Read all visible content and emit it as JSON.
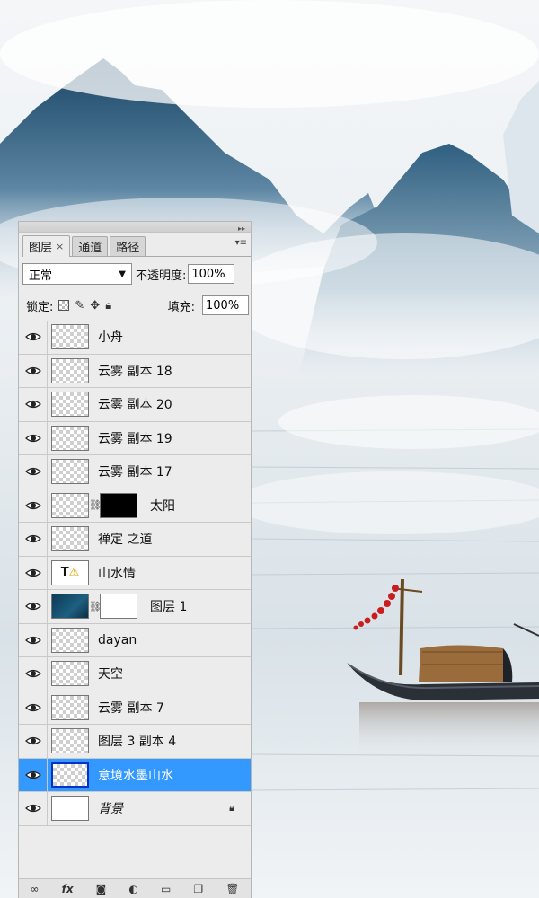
{
  "panel": {
    "tabs": [
      {
        "label": "图层",
        "close": "×"
      },
      {
        "label": "通道"
      },
      {
        "label": "路径"
      }
    ],
    "blend_mode": "正常",
    "opacity_label": "不透明度:",
    "opacity_value": "100%",
    "lock_label": "锁定:",
    "fill_label": "填充:",
    "fill_value": "100%"
  },
  "layers": [
    {
      "name": "小舟",
      "thumb": "transparent",
      "visible": true
    },
    {
      "name": "云雾 副本 18",
      "thumb": "transparent",
      "visible": true
    },
    {
      "name": "云雾 副本 20",
      "thumb": "transparent",
      "visible": true
    },
    {
      "name": "云雾 副本 19",
      "thumb": "transparent",
      "visible": true
    },
    {
      "name": "云雾 副本 17",
      "thumb": "transparent",
      "visible": true
    },
    {
      "name": "太阳",
      "thumb": "transparent",
      "mask": "black",
      "visible": true
    },
    {
      "name": "禅定 之道",
      "thumb": "transparent",
      "visible": true
    },
    {
      "name": "山水情",
      "thumb": "type",
      "thumb_text": "T",
      "visible": true
    },
    {
      "name": "图层 1",
      "thumb": "dark",
      "mask": "white",
      "visible": true
    },
    {
      "name": "dayan",
      "thumb": "transparent",
      "visible": true
    },
    {
      "name": "天空",
      "thumb": "transparent",
      "visible": true
    },
    {
      "name": "云雾 副本 7",
      "thumb": "transparent",
      "visible": true
    },
    {
      "name": "图层 3 副本 4",
      "thumb": "transparent",
      "visible": true
    },
    {
      "name": "意境水墨山水",
      "thumb": "transparent",
      "visible": true,
      "selected": true
    },
    {
      "name": "背景",
      "thumb": "white",
      "visible": true,
      "locked": true
    }
  ],
  "footer_icons": [
    "link-layers-icon",
    "fx-icon",
    "add-mask-icon",
    "adjustment-icon",
    "group-folder-icon",
    "new-layer-icon",
    "trash-icon"
  ],
  "footer_fx": "fx",
  "colors": {
    "selection": "#3399ff",
    "mountain": "#1f4e6e",
    "boat_hull": "#2b2f36"
  }
}
